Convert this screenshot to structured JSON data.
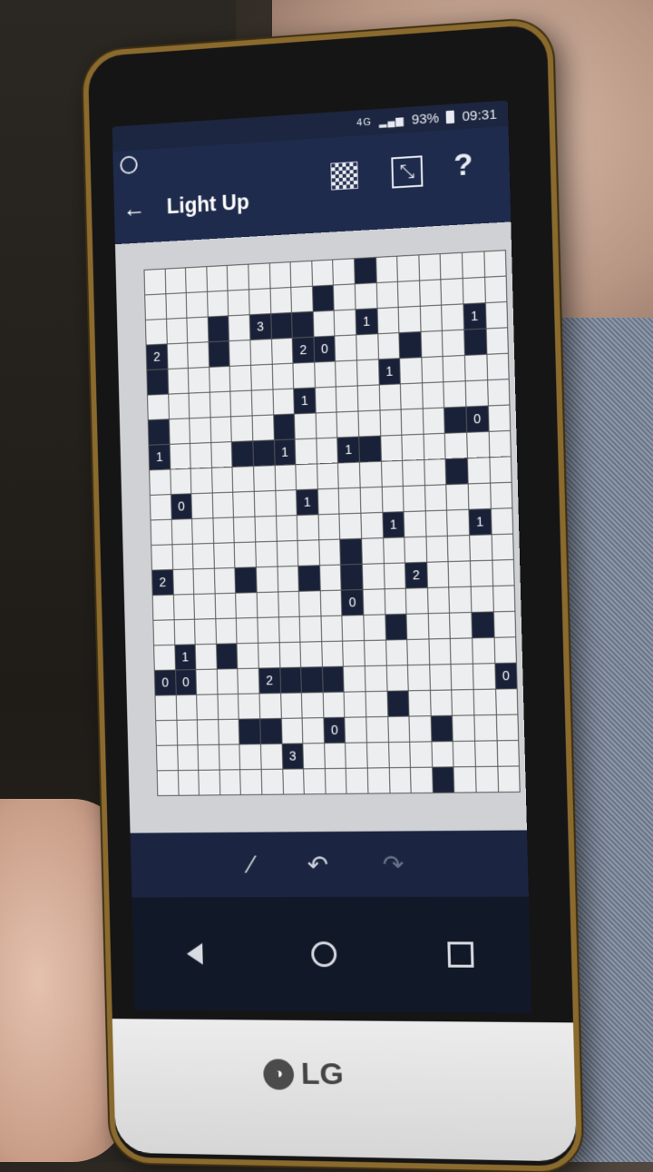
{
  "status": {
    "battery": "93%",
    "time": "09:31",
    "network": "4G"
  },
  "appbar": {
    "title": "Light Up",
    "back_icon": "←",
    "resize_icon": "⤡",
    "help_icon": "?"
  },
  "brand": {
    "logo_text": "LG"
  },
  "puzzle": {
    "rows": 21,
    "cols": 17,
    "grid": [
      "..........#......",
      "........#........",
      "...#.3##..1....1.",
      "2..#...20...#..#.",
      "#..........1.....",
      ".......1.........",
      "#.....#.......#0.",
      "1...##1..1#......",
      "..............#..",
      ".0.....1.........",
      "...........1...1.",
      ".........#.......",
      "2...#..#.#..2....",
      ".........0.......",
      "...........#...#.",
      ".1.#.............",
      "00...2###.......0",
      "...........#.....",
      "....##..0....#...",
      "......3..........",
      ".............#..."
    ]
  }
}
